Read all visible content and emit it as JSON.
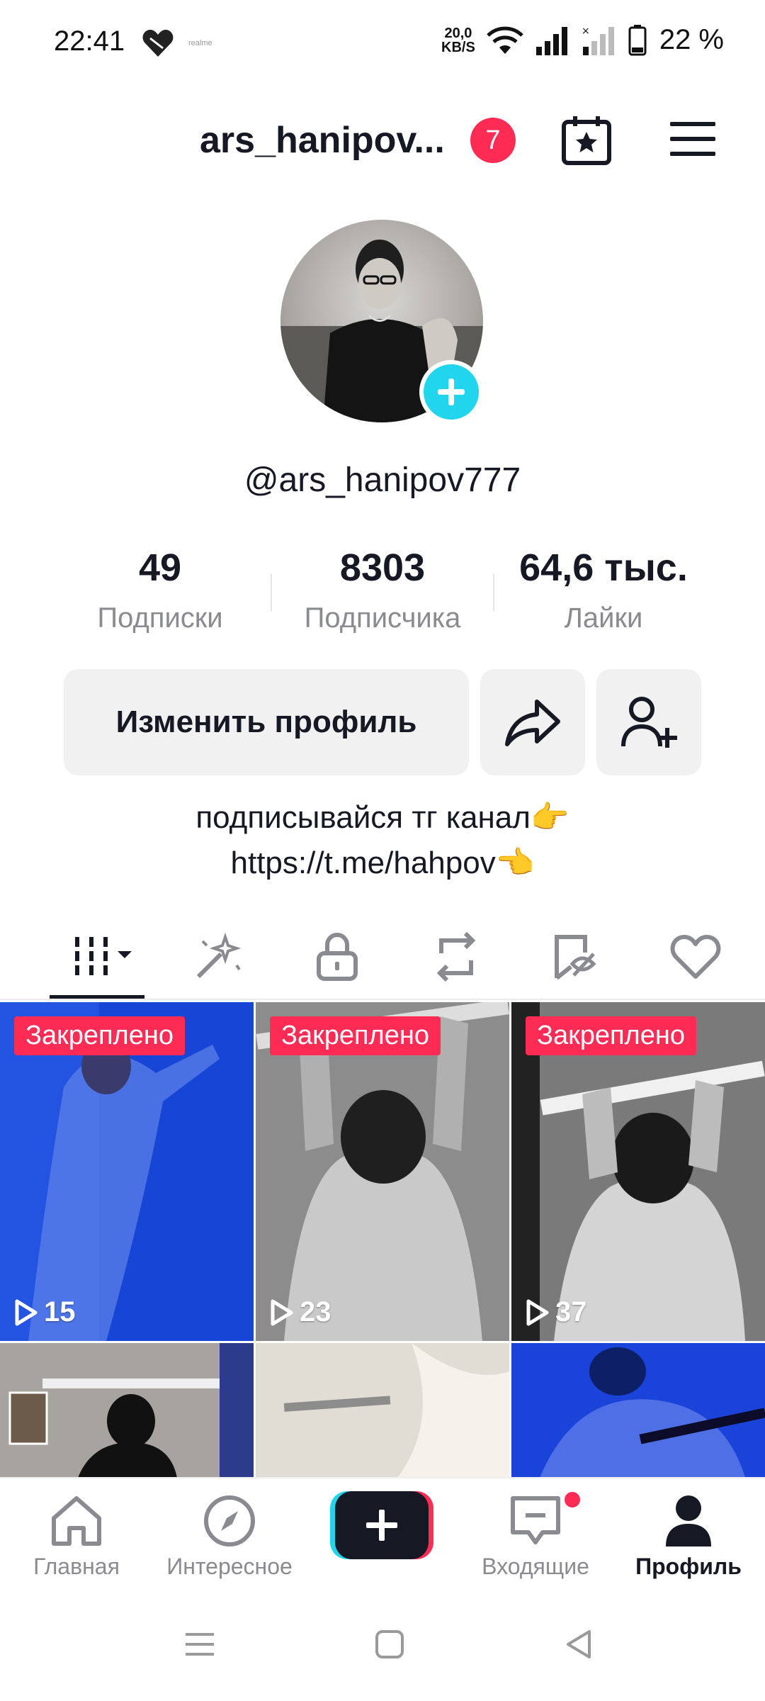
{
  "status_bar": {
    "time": "22:41",
    "realme_text": "realme",
    "net_speed_value": "20,0",
    "net_speed_unit": "KB/S",
    "battery_percent": "22 %",
    "icons": [
      "heart-icon",
      "wifi-icon",
      "signal-icon",
      "signal-no-sim-icon",
      "battery-icon"
    ]
  },
  "header": {
    "username": "ars_hanipov...",
    "notification_count": "7",
    "icons": [
      "calendar-star-icon",
      "hamburger-menu-icon"
    ]
  },
  "profile": {
    "handle": "@ars_hanipov777",
    "avatar_add_icon": "plus-icon"
  },
  "stats": [
    {
      "value": "49",
      "label": "Подписки"
    },
    {
      "value": "8303",
      "label": "Подписчика"
    },
    {
      "value": "64,6 тыс.",
      "label": "Лайки"
    }
  ],
  "actions": {
    "edit_label": "Изменить профиль",
    "share_icon": "share-arrow-icon",
    "add_friend_icon": "add-user-icon"
  },
  "bio": {
    "line1": "подписывайся тг канал👉",
    "line2": "https://t.me/hahpov👈"
  },
  "tabs": [
    "videos-grid-icon",
    "magic-wand-icon",
    "lock-icon",
    "repost-icon",
    "favorites-icon",
    "heart-outline-icon"
  ],
  "videos": [
    {
      "pinned_label": "Закреплено",
      "views": "15",
      "color": "#1746d6"
    },
    {
      "pinned_label": "Закреплено",
      "views": "23",
      "color": "#7a7a7a"
    },
    {
      "pinned_label": "Закреплено",
      "views": "37",
      "color": "#6b6b6b"
    },
    {
      "pinned_label": "",
      "views": "",
      "color": "#a7a4a0"
    },
    {
      "pinned_label": "",
      "views": "",
      "color": "#d9d3c9"
    },
    {
      "pinned_label": "",
      "views": "",
      "color": "#1a43d9"
    }
  ],
  "bottom_nav": {
    "home": "Главная",
    "discover": "Интересное",
    "inbox": "Входящие",
    "profile": "Профиль"
  },
  "colors": {
    "accent": "#fe2c55",
    "cyan": "#20d5ec",
    "text": "#161823",
    "muted": "#8a8b91"
  }
}
